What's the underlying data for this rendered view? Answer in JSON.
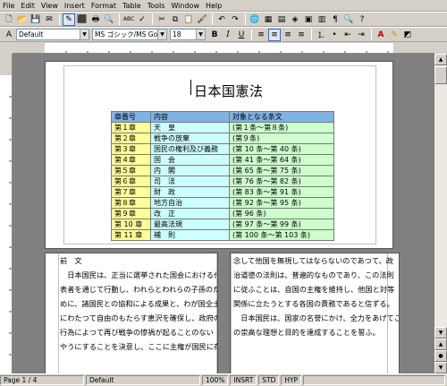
{
  "menu": [
    "File",
    "Edit",
    "View",
    "Insert",
    "Format",
    "Table",
    "Tools",
    "Window",
    "Help"
  ],
  "toolbar": {
    "style": "Default",
    "font": "MS ゴシック/MS Gothic",
    "size": "18",
    "bold": "B",
    "italic": "I",
    "underline": "U",
    "font_color_glyph": "A"
  },
  "icons": {
    "new": "🗋",
    "open": "📂",
    "save": "💾",
    "mail": "✉",
    "edit": "✎",
    "export": "⬛",
    "print": "🖶",
    "preview": "🔍",
    "spell": "ABC",
    "autospell": "✓",
    "cut": "✂",
    "copy": "⧉",
    "paste": "📋",
    "brush": "🖌",
    "undo": "↶",
    "redo": "↷",
    "hyper": "🌐",
    "table": "▦",
    "show": "▤",
    "navigator": "◈",
    "gallery": "▣",
    "datasrc": "▥",
    "para": "¶",
    "zoom": "🔍",
    "help": "?"
  },
  "document": {
    "title": "日本国憲法",
    "table": {
      "headers": [
        "章番号",
        "内容",
        "対象となる条文"
      ],
      "rows": [
        [
          "第１章",
          "天　皇",
          "(第１条～第８条)"
        ],
        [
          "第２章",
          "戦争の放棄",
          "(第９条)"
        ],
        [
          "第３章",
          "国民の権利及び義務",
          "(第 10 条～第 40 条)"
        ],
        [
          "第４章",
          "国　会",
          "(第 41 条～第 64 条)"
        ],
        [
          "第５章",
          "内　閣",
          "(第 65 条～第 75 条)"
        ],
        [
          "第６章",
          "司　法",
          "(第 76 条～第 82 条)"
        ],
        [
          "第７章",
          "財　政",
          "(第 83 条～第 91 条)"
        ],
        [
          "第８章",
          "地方自治",
          "(第 92 条～第 95 条)"
        ],
        [
          "第９章",
          "改　正",
          "(第 96 条)"
        ],
        [
          "第 10 章",
          "最高法規",
          "(第 97 条～第 99 条)"
        ],
        [
          "第 11 章",
          "補　則",
          "(第 100 条～第 103 条)"
        ]
      ]
    },
    "preamble_heading": "前　文",
    "col1": [
      "　日本国民は、正当に選挙された国会における代",
      "表者を通じて行動し、われらとわれらの子孫のた",
      "めに、諸国民との協和による成果と、わが国全土",
      "にわたつて自由のもたらす恵沢を確保し、政府の",
      "行為によつて再び戦争の惨禍が起ることのない",
      "やうにすることを決意し、ここに主権が国民に存"
    ],
    "col2": [
      "念して他国を無視してはならないのであつて、政",
      "治道徳の法則は、普遍的なものであり、この法則",
      "に従ふことは、自国の主権を維持し、他国と対等",
      "関係に立たうとする各国の責務であると信ずる。",
      "　日本国民は、国家の名誉にかけ、全力をあげてこ",
      "の崇高な理想と目的を達成することを誓ふ。"
    ]
  },
  "status": {
    "page": "Page 1 / 4",
    "style": "Default",
    "zoom": "100%",
    "insert": "INSRT",
    "std": "STD",
    "hyp": "HYP"
  }
}
